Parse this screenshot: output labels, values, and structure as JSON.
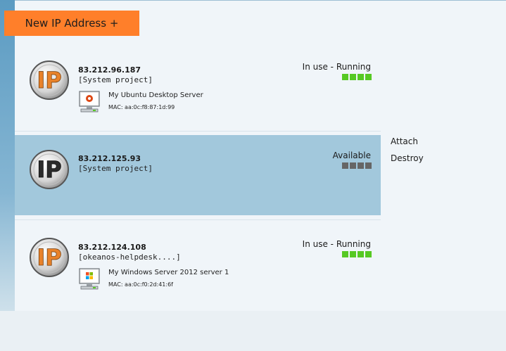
{
  "toolbar": {
    "new_ip_label": "New IP Address +"
  },
  "ips": [
    {
      "address": "83.212.96.187",
      "project": "[System project]",
      "status": "In use - Running",
      "status_color": "#56c923",
      "logo_color": "#e8822a",
      "vm": {
        "name": "My Ubuntu Desktop Server",
        "mac": "MAC: aa:0c:f8:87:1d:99",
        "os_icon": "ubuntu-icon"
      }
    },
    {
      "address": "83.212.125.93",
      "project": "[System project]",
      "status": "Available",
      "status_color": "#666666",
      "logo_color": "#2b2b2b"
    },
    {
      "address": "83.212.124.108",
      "project": "[okeanos-helpdesk....]",
      "status": "In use - Running",
      "status_color": "#56c923",
      "logo_color": "#e8822a",
      "vm": {
        "name": "My Windows Server 2012 server 1",
        "mac": "MAC: aa:0c:f0:2d:41:6f",
        "os_icon": "windows-icon"
      }
    }
  ],
  "actions": {
    "attach": "Attach",
    "destroy": "Destroy"
  },
  "colors": {
    "accent": "#ff7f2a",
    "selected_row": "#a2c8dc"
  }
}
